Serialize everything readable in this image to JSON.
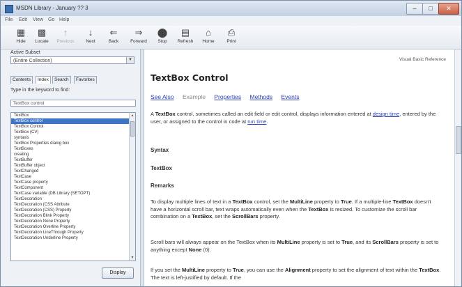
{
  "window": {
    "title": "MSDN Library - January ?? 3"
  },
  "menu": [
    "File",
    "Edit",
    "View",
    "Go",
    "Help"
  ],
  "toolbar": [
    {
      "label": "Hide",
      "icon": "hide-icon"
    },
    {
      "label": "Locate",
      "icon": "locate-icon"
    },
    {
      "label": "Previous",
      "icon": "previous-icon",
      "disabled": true
    },
    {
      "label": "Next",
      "icon": "next-icon"
    },
    {
      "label": "Back",
      "icon": "back-icon"
    },
    {
      "label": "Forward",
      "icon": "forward-icon"
    },
    {
      "label": "Stop",
      "icon": "stop-icon"
    },
    {
      "label": "Refresh",
      "icon": "refresh-icon"
    },
    {
      "label": "Home",
      "icon": "home-icon"
    },
    {
      "label": "Print",
      "icon": "print-icon"
    }
  ],
  "left": {
    "subset_label": "Active Subset",
    "subset_value": "(Entire Collection)",
    "tabs": [
      "Contents",
      "Index",
      "Search",
      "Favorites"
    ],
    "keyword_label": "Type in the keyword to find:",
    "keyword_value": "TextBox control",
    "items": [
      "TextBox",
      "TextBox control",
      "TextBox Control",
      "TextBox (CV)",
      "   syntaxis",
      "TextBox Properties dialog box",
      "TextBoxes",
      "   creating",
      "TextBuffer",
      "TextBuffer object",
      "TextChanged",
      "TextCase",
      "TextCase property",
      "TextComponent",
      "TextCase variable (DB Library (SETOPT)",
      "TextDecoration",
      "TextDecoration (CSS Attribute",
      "TextDecoration (CSS) Property",
      "TextDecoration Blink Property",
      "TextDecoration None Property",
      "TextDecoration Overline Property",
      "TextDecoration LineThrough Property",
      "TextDecoration Underline Property"
    ],
    "selected_index": 1,
    "display_button": "Display"
  },
  "content": {
    "ref": "Visual Basic Reference",
    "title": "TextBox Control",
    "links": [
      "See Also",
      "Example",
      "Properties",
      "Methods",
      "Events"
    ],
    "intro": [
      "A ",
      "TextBox",
      " control, sometimes called an edit field or edit control, displays information entered at ",
      "design time",
      ", entered by the user, or assigned to the control in code at ",
      "run time",
      "."
    ],
    "syntax_heading": "Syntax",
    "syntax_value": "TextBox",
    "remarks_heading": "Remarks",
    "remarks_1": [
      "To display multiple lines of text in a ",
      "TextBox",
      " control, set the ",
      "MultiLine",
      " property to ",
      "True",
      ". If a multiple-line ",
      "TextBox",
      " doesn't have a horizontal scroll bar, text wraps automatically even when the ",
      "TextBox",
      " is resized. To customize the scroll bar combination on a ",
      "TextBox",
      ", set the ",
      "ScrollBars",
      " property."
    ],
    "remarks_2": [
      "Scroll bars will always appear on the TextBox when its ",
      "MultiLine",
      " property is set to ",
      "True",
      ", and its ",
      "ScrollBars",
      " property is set to anything except ",
      "None",
      " (0)."
    ],
    "remarks_3": [
      "If you set the ",
      "MultiLine",
      " property to ",
      "True",
      ", you can use the ",
      "Alignment",
      " property to set the alignment of text within the ",
      "TextBox",
      ". The text is left-justified by default. If the"
    ]
  }
}
